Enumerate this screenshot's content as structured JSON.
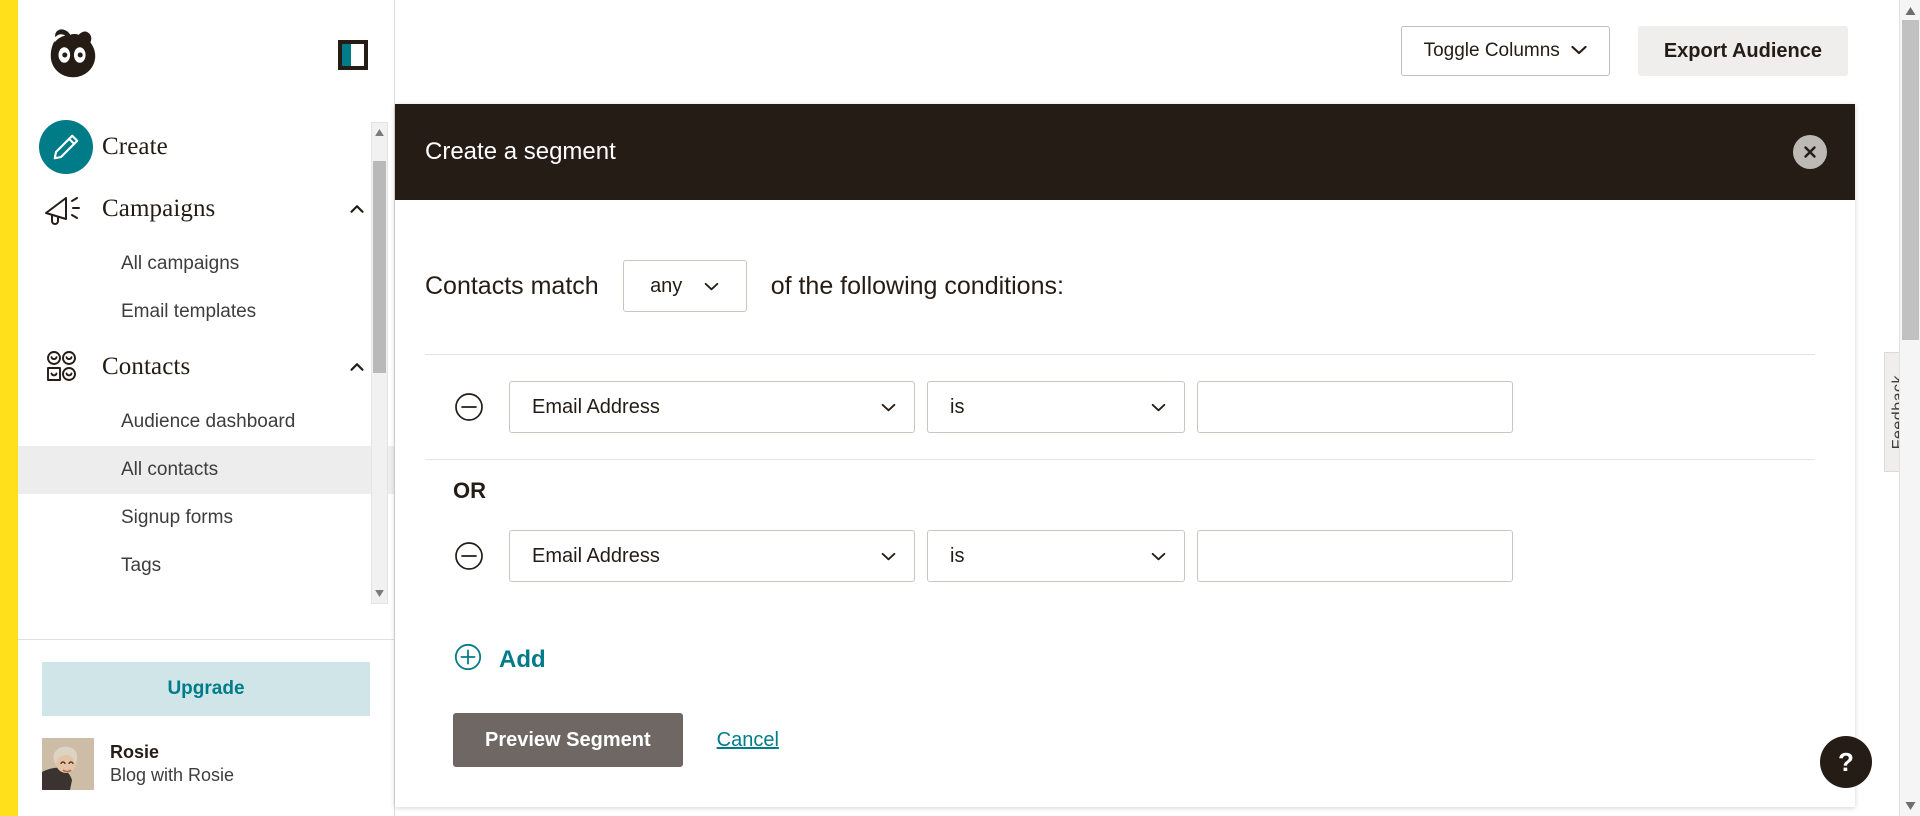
{
  "brand": {
    "accent": "#007c89",
    "rail_color": "#ffe01b",
    "dark": "#241c15"
  },
  "sidebar": {
    "logo_name": "mailchimp-freddie-logo",
    "panel_toggle_name": "panel-toggle-icon",
    "nav": [
      {
        "label": "Create",
        "icon": "pencil-icon",
        "type": "primary"
      },
      {
        "label": "Campaigns",
        "icon": "megaphone-icon",
        "type": "group",
        "expanded": true
      },
      {
        "label": "All campaigns",
        "type": "sub",
        "active": false
      },
      {
        "label": "Email templates",
        "type": "sub",
        "active": false
      },
      {
        "label": "Contacts",
        "icon": "contacts-icon",
        "type": "group",
        "expanded": true
      },
      {
        "label": "Audience dashboard",
        "type": "sub",
        "active": false
      },
      {
        "label": "All contacts",
        "type": "sub",
        "active": true
      },
      {
        "label": "Signup forms",
        "type": "sub",
        "active": false
      },
      {
        "label": "Tags",
        "type": "sub",
        "active": false
      }
    ],
    "upgrade_label": "Upgrade",
    "profile": {
      "name": "Rosie",
      "account": "Blog with Rosie"
    }
  },
  "toolbar": {
    "toggle_columns_label": "Toggle Columns",
    "export_audience_label": "Export Audience"
  },
  "modal": {
    "title": "Create a segment",
    "close_label": "×",
    "match_prefix": "Contacts match",
    "match_value": "any",
    "match_suffix": "of the following conditions:",
    "or_label": "OR",
    "conditions": [
      {
        "field": "Email Address",
        "operator": "is",
        "value": ""
      },
      {
        "field": "Email Address",
        "operator": "is",
        "value": ""
      }
    ],
    "add_label": "Add",
    "preview_label": "Preview Segment",
    "cancel_label": "Cancel"
  },
  "edge": {
    "feedback_label": "Feedback",
    "help_label": "?"
  }
}
